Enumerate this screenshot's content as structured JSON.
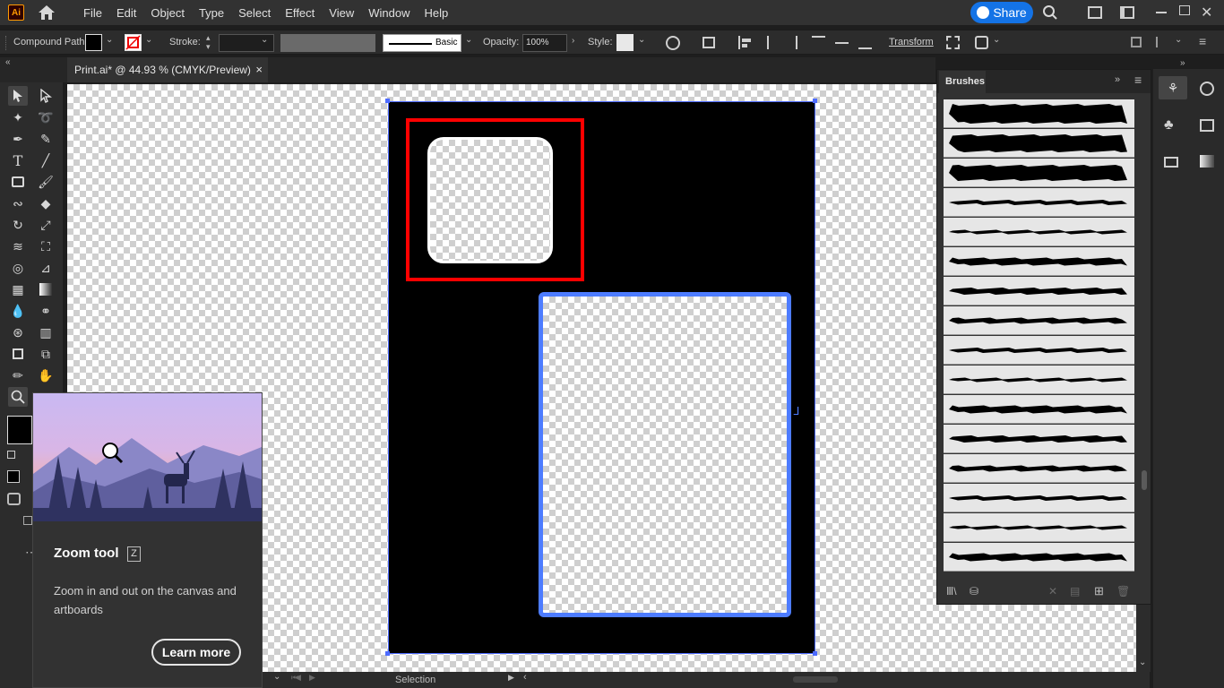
{
  "app": {
    "logo": "Ai",
    "share_label": "Share"
  },
  "menu": [
    "File",
    "Edit",
    "Object",
    "Type",
    "Select",
    "Effect",
    "View",
    "Window",
    "Help"
  ],
  "control_bar": {
    "selection_type": "Compound Path",
    "stroke_label": "Stroke:",
    "stroke_style": "Basic",
    "opacity_label": "Opacity:",
    "opacity_value": "100%",
    "style_label": "Style:",
    "transform_label": "Transform"
  },
  "document": {
    "tab_title": "Print.ai* @ 44.93 % (CMYK/Preview)",
    "close_glyph": "×"
  },
  "tooltip": {
    "title": "Zoom tool",
    "shortcut": "Z",
    "description": "Zoom in and out on the canvas and artboards",
    "button": "Learn more"
  },
  "brushes_panel": {
    "title": "Brushes",
    "brush_count": 16
  },
  "status_bar": {
    "tool_name": "Selection"
  },
  "colors": {
    "accent": "#1473e6",
    "selection_red": "#ff0000",
    "selection_blue": "#4d7cff",
    "artboard": "#000000"
  }
}
